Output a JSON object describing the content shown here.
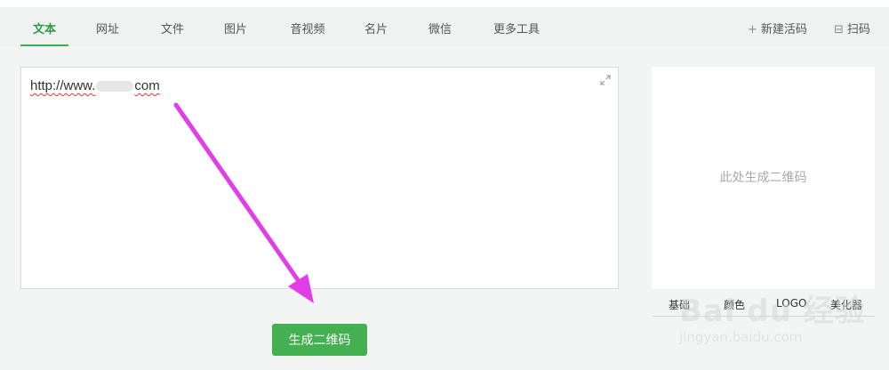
{
  "tabs": [
    {
      "label": "文本"
    },
    {
      "label": "网址"
    },
    {
      "label": "文件"
    },
    {
      "label": "图片"
    },
    {
      "label": "音视频"
    },
    {
      "label": "名片"
    },
    {
      "label": "微信"
    },
    {
      "label": "更多工具"
    }
  ],
  "toolbar": {
    "new_code_label": "新建活码",
    "scan_label": "扫码"
  },
  "editor": {
    "text_prefix": "http://www.",
    "text_suffix": "com"
  },
  "generate_button": {
    "label": "生成二维码"
  },
  "preview": {
    "placeholder": "此处生成二维码"
  },
  "options": {
    "basic": "基础",
    "color": "颜色",
    "logo": "LOGO",
    "beautify": "美化器"
  },
  "watermark": {
    "logo_text": "Bai du 经验",
    "url": "jingyan.baidu.com"
  },
  "colors": {
    "accent": "#44b052",
    "arrow": "#e23ee8"
  }
}
